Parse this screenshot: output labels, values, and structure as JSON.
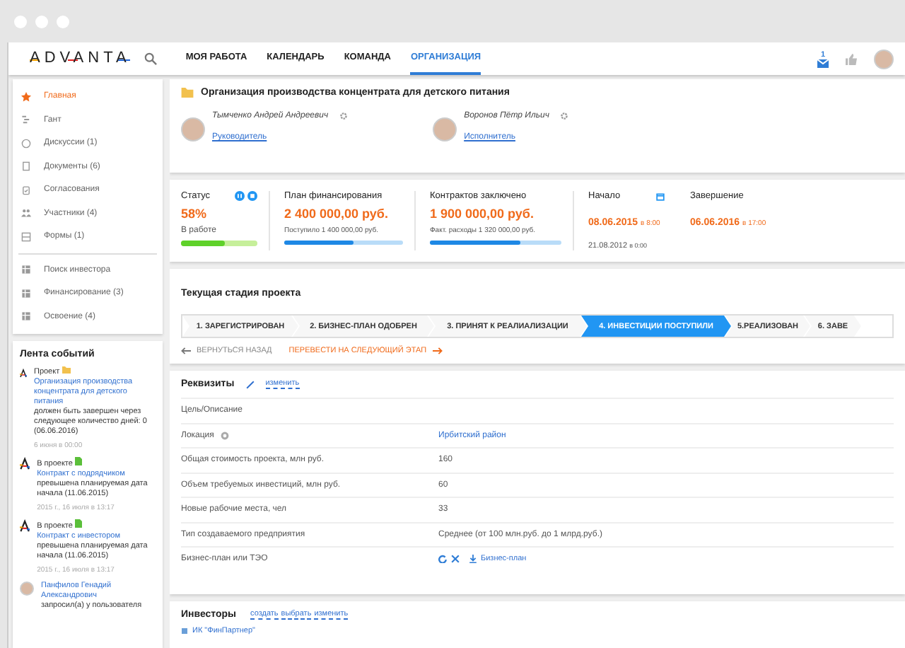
{
  "header": {
    "logo": "ADVANTA",
    "nav": [
      {
        "label": "МОЯ РАБОТА",
        "selected": false
      },
      {
        "label": "КАЛЕНДАРЬ",
        "selected": false
      },
      {
        "label": "КОМАНДА",
        "selected": false
      },
      {
        "label": "ОРГАНИЗАЦИЯ",
        "selected": true
      }
    ],
    "mail_count": "1"
  },
  "sidebar": {
    "groups": [
      [
        {
          "label": "Главная",
          "selected": true
        },
        {
          "label": "Гант",
          "selected": false
        },
        {
          "label": "Дискуссии (1)",
          "selected": false
        },
        {
          "label": "Документы (6)",
          "selected": false
        },
        {
          "label": "Согласования",
          "selected": false
        },
        {
          "label": "Участники (4)",
          "selected": false
        },
        {
          "label": "Формы (1)",
          "selected": false
        }
      ],
      [
        {
          "label": "Поиск инвестора",
          "selected": false
        },
        {
          "label": "Финансирование (3)",
          "selected": false
        },
        {
          "label": "Освоение (4)",
          "selected": false
        }
      ]
    ]
  },
  "feed": {
    "title": "Лента событий",
    "items": [
      {
        "kind": "project",
        "prefix": "Проект",
        "link": "Организация производства концентрата для детского питания",
        "suffix": "должен быть завершен через следующее количество дней: 0 (06.06.2016)",
        "time": "6 июня в 00:00"
      },
      {
        "kind": "contract",
        "prefix": "В проекте",
        "link": "Контракт с подрядчиком",
        "suffix": "превышена планируемая дата начала (11.06.2015)",
        "time": "2015 г., 16 июля в 13:17"
      },
      {
        "kind": "contract",
        "prefix": "В проекте",
        "link": "Контракт с инвестором",
        "suffix": "превышена планируемая дата начала (11.06.2015)",
        "time": "2015 г., 16 июля в 13:17"
      },
      {
        "kind": "user",
        "link": "Панфилов Генадий Александрович",
        "suffix": "запросил(а) у пользователя"
      }
    ]
  },
  "project": {
    "title": "Организация производства концентрата для детского питания",
    "people": [
      {
        "name": "Тымченко Андрей Андреевич",
        "role": "Руководитель"
      },
      {
        "name": "Воронов Пётр Ильич",
        "role": "Исполнитель"
      }
    ]
  },
  "stats": {
    "status": {
      "label": "Статус",
      "value": "58%",
      "note": "В работе",
      "level": 0.58
    },
    "finance": [
      {
        "label": "План финансирования",
        "value": "2 400 000,00 руб.",
        "note": "Поступило 1 400 000,00 руб.",
        "level": 0.58
      },
      {
        "label": "Контрактов заключено",
        "value": "1 900 000,00 руб.",
        "note": "Факт. расходы 1 320 000,00 руб.",
        "level": 0.69
      }
    ],
    "dates": [
      {
        "label": "Начало",
        "date": "08.06.2015",
        "time": "в 8:00",
        "extra_date": "21.08.2012",
        "extra_time": "в 0:00"
      },
      {
        "label": "Завершение",
        "date": "06.06.2016",
        "time": "в 17:00"
      }
    ]
  },
  "stage": {
    "title": "Текущая стадия проекта",
    "steps": [
      {
        "label": "1. ЗАРЕГИСТРИРОВАН",
        "selected": false
      },
      {
        "label": "2. БИЗНЕС-ПЛАН ОДОБРЕН",
        "selected": false
      },
      {
        "label": "3. ПРИНЯТ К РЕАЛИАЛИЗАЦИИ",
        "selected": false
      },
      {
        "label": "4. ИНВЕСТИЦИИ ПОСТУПИЛИ",
        "selected": true
      },
      {
        "label": "5.РЕАЛИЗОВАН",
        "selected": false
      },
      {
        "label": "6. ЗАВЕ",
        "selected": false
      }
    ],
    "back": "ВЕРНУТЬСЯ НАЗАД",
    "next": "ПЕРЕВЕСТИ НА СЛЕДУЮЩИЙ ЭТАП"
  },
  "requisites": {
    "title": "Реквизиты",
    "edit": "изменить",
    "rows": [
      {
        "label": "Цель/Описание",
        "kind": "text"
      },
      {
        "label": "Локация",
        "kind": "link",
        "help": true,
        "value": "Ирбитский район"
      },
      {
        "label": "Общая стоимость проекта, млн руб.",
        "kind": "text",
        "value": "160"
      },
      {
        "label": "Объем требуемых инвестиций, млн руб.",
        "kind": "text",
        "value": "60"
      },
      {
        "label": "Новые рабочие места, чел",
        "kind": "text",
        "value": "33"
      },
      {
        "label": "Тип создаваемого предприятия",
        "kind": "text",
        "value": "Среднее (от 100 млн.руб. до 1 млрд.руб.)"
      },
      {
        "label": "Бизнес-план или ТЭО",
        "kind": "file",
        "value": "Бизнес-план"
      }
    ]
  },
  "investors": {
    "title": "Инвесторы",
    "actions": [
      "создать",
      "выбрать",
      "изменить"
    ],
    "items": [
      "ИК \"ФинПартнер\""
    ]
  }
}
